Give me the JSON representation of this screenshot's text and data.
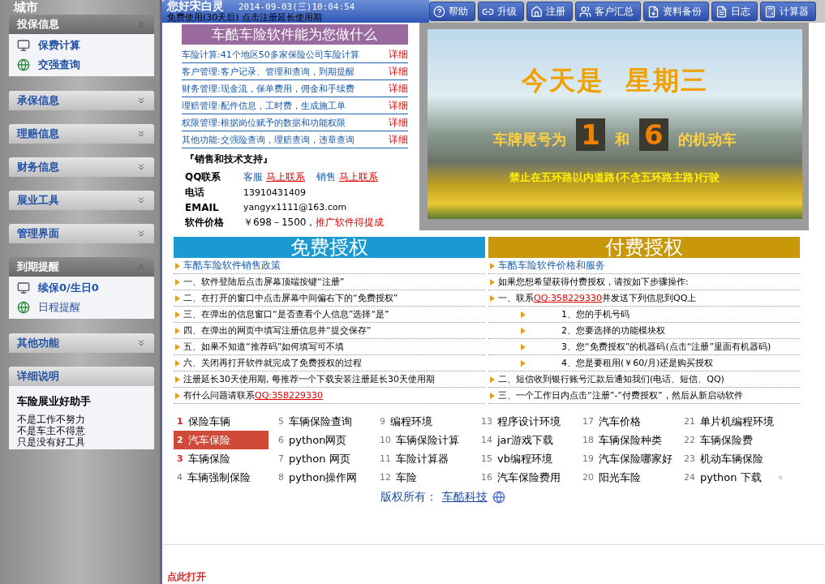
{
  "sidebar": {
    "title": "城市",
    "groups": [
      {
        "kind": "links",
        "label": "投保信息",
        "expanded": true,
        "items": [
          {
            "label": "保费计算",
            "bold": true
          },
          {
            "label": "交强查询",
            "bold": true
          }
        ]
      },
      {
        "kind": "links",
        "label": "承保信息",
        "expanded": false
      },
      {
        "kind": "links",
        "label": "理赔信息",
        "expanded": false
      },
      {
        "kind": "links",
        "label": "财务信息",
        "expanded": false
      },
      {
        "kind": "links",
        "label": "展业工具",
        "expanded": false
      },
      {
        "kind": "links",
        "label": "管理界面",
        "expanded": false
      },
      {
        "kind": "links",
        "label": "到期提醒",
        "expanded": true,
        "items": [
          {
            "label": "续保0/生日0",
            "bold": true
          },
          {
            "label": "日程提醒",
            "bold": false
          }
        ]
      },
      {
        "kind": "links",
        "label": "其他功能",
        "expanded": false
      },
      {
        "kind": "notes",
        "label": "详细说明",
        "heading": "车险展业好助手",
        "lines": [
          "不是工作不努力",
          "不是车主不得意",
          "只是没有好工具"
        ]
      }
    ]
  },
  "header": {
    "greeting": "您好宋白灵",
    "datetime": "2014-09-03(三)10:04:54",
    "notice": "免费使用(30天后) 点击注册延长使用期"
  },
  "toolbar": [
    {
      "label": "帮助"
    },
    {
      "label": "升级"
    },
    {
      "label": "注册"
    },
    {
      "label": "客户汇总"
    },
    {
      "label": "资料备份"
    },
    {
      "label": "日志"
    },
    {
      "label": "计算器"
    }
  ],
  "features": {
    "title": "车酷车险软件能为您做什么",
    "items": [
      {
        "text": "车险计算:41个地区50多家保险公司车险计算",
        "link": "详细"
      },
      {
        "text": "客户管理:客户记录、管理和查询，到期提醒",
        "link": "详细"
      },
      {
        "text": "财务管理:现金流，保单费用，佣金和手续费",
        "link": "详细"
      },
      {
        "text": "理赔管理:配件信息，工时费，生成施工单",
        "link": "详细"
      },
      {
        "text": "权限管理:根据岗位赋予的数据和功能权限",
        "link": "详细"
      },
      {
        "text": "其他功能:交强险查询，理赔查询，违章查询",
        "link": "详细"
      }
    ]
  },
  "support": {
    "title": "『销售和技术支持』",
    "rows": [
      {
        "kind": "links",
        "label": "QQ联系",
        "links": [
          {
            "name": "客服",
            "action": "马上联系"
          },
          {
            "name": "销售",
            "action": "马上联系"
          }
        ]
      },
      {
        "kind": "value",
        "label": "电话",
        "value": "13910431409"
      },
      {
        "kind": "value",
        "label": "EMAIL",
        "value": "yangyx1111@163.com"
      },
      {
        "kind": "price",
        "label": "软件价格",
        "value": "￥698－1500，",
        "highlight": "推广软件得提成"
      }
    ]
  },
  "banner": {
    "title": "今天是  星期三",
    "prefix": "车牌尾号为",
    "digits": [
      "1",
      "6"
    ],
    "joiner": "和",
    "suffix": "的机动车",
    "rule": "禁止在五环路以内道路(不含五环路主路)行驶"
  },
  "free": {
    "title": "免费授权",
    "items": [
      {
        "kind": "link",
        "text": "车酷车险软件销售政策"
      },
      {
        "kind": "text",
        "text": "一、软件登陆后点击屏幕顶端按键“注册”"
      },
      {
        "kind": "text",
        "text": "二、在打开的窗口中点击屏幕中间偏右下的“免费授权”"
      },
      {
        "kind": "text",
        "text": "三、在弹出的信息窗口“是否查看个人信息”选择“是”"
      },
      {
        "kind": "text",
        "text": "四、在弹出的网页中填写注册信息并“提交保存”"
      },
      {
        "kind": "text",
        "text": "五、如果不知道“推荐码”如何填写可不填"
      },
      {
        "kind": "text",
        "text": "六、关闭再打开软件就完成了免费授权的过程"
      },
      {
        "kind": "text",
        "text": "注册延长30天使用期, 每推荐一个下载安装注册延长30天使用期"
      },
      {
        "kind": "contact",
        "text": "有什么问题请联系",
        "qq": "QQ:358229330"
      }
    ]
  },
  "paid": {
    "title": "付费授权",
    "items": [
      {
        "kind": "link",
        "text": "车酷车险软件价格和服务"
      },
      {
        "kind": "text",
        "text": "如果您想希望获得付费授权，请按如下步骤操作:"
      },
      {
        "kind": "contact",
        "text": "一、联系",
        "qq": "QQ:358229330",
        "after": "并发送下列信息到QQ上"
      },
      {
        "kind": "indent",
        "text": "1、您的手机号码"
      },
      {
        "kind": "indent",
        "text": "2、您要选择的功能模块权"
      },
      {
        "kind": "indent",
        "text": "3、您“免费授权”的机器码(点击“注册”里面有机器码)"
      },
      {
        "kind": "indent",
        "text": "4、您是要租用(￥60/月)还是购买授权"
      },
      {
        "kind": "text",
        "text": "二、短信收到银行账号汇款后通知我们(电话、短信、QQ)"
      },
      {
        "kind": "text",
        "text": "三、一个工作日内点击“注册”-“付费授权”，然后从新启动软件"
      }
    ]
  },
  "hot_links": [
    {
      "num": "1",
      "label": "保险车辆",
      "hot": true,
      "selected": false
    },
    {
      "num": "5",
      "label": "车辆保险查询",
      "hot": false,
      "selected": false
    },
    {
      "num": "9",
      "label": "编程环境",
      "hot": false,
      "selected": false
    },
    {
      "num": "13",
      "label": "程序设计环境",
      "hot": false,
      "selected": false
    },
    {
      "num": "17",
      "label": "汽车价格",
      "hot": false,
      "selected": false
    },
    {
      "num": "21",
      "label": "单片机编程环境",
      "hot": false,
      "selected": false
    },
    {
      "num": "2",
      "label": "汽车保险",
      "hot": true,
      "selected": true
    },
    {
      "num": "6",
      "label": "python网页",
      "hot": false,
      "selected": false
    },
    {
      "num": "10",
      "label": "车辆保险计算",
      "hot": false,
      "selected": false
    },
    {
      "num": "14",
      "label": "jar游戏下载",
      "hot": false,
      "selected": false
    },
    {
      "num": "18",
      "label": "车辆保险种类",
      "hot": false,
      "selected": false
    },
    {
      "num": "22",
      "label": "车辆保险费",
      "hot": false,
      "selected": false
    },
    {
      "num": "3",
      "label": "车辆保险",
      "hot": true,
      "selected": false
    },
    {
      "num": "7",
      "label": "python 网页",
      "hot": false,
      "selected": false
    },
    {
      "num": "11",
      "label": "车险计算器",
      "hot": false,
      "selected": false
    },
    {
      "num": "15",
      "label": "vb编程环境",
      "hot": false,
      "selected": false
    },
    {
      "num": "19",
      "label": "汽车保险哪家好",
      "hot": false,
      "selected": false
    },
    {
      "num": "23",
      "label": "机动车辆保险",
      "hot": false,
      "selected": false
    },
    {
      "num": "4",
      "label": "车辆强制保险",
      "hot": false,
      "selected": false
    },
    {
      "num": "8",
      "label": "python操作网",
      "hot": false,
      "selected": false
    },
    {
      "num": "12",
      "label": "车险",
      "hot": false,
      "selected": false
    },
    {
      "num": "16",
      "label": "汽车保险费用",
      "hot": false,
      "selected": false
    },
    {
      "num": "20",
      "label": "阳光车险",
      "hot": false,
      "selected": false
    },
    {
      "num": "24",
      "label": "python 下载",
      "hot": false,
      "selected": false
    }
  ],
  "copyright": {
    "label": "版权所有：",
    "link": "车酷科技"
  },
  "open_link": "点此打开"
}
